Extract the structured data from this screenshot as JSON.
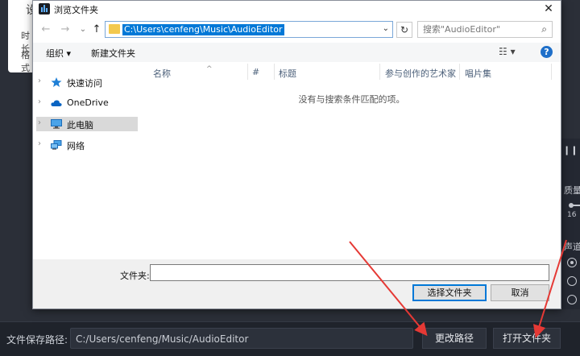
{
  "background": {
    "settings_panel": {
      "title": "设",
      "row1": "时长",
      "row2": "格式"
    },
    "right_panel": {
      "pause_glyph": "❙❙",
      "quality_label": "质量",
      "quality_value": "16",
      "channel_label": "声道"
    },
    "bottom_bar": {
      "save_path_label": "文件保存路径:",
      "save_path_value": "C:/Users/cenfeng/Music/AudioEditor",
      "change_path_button": "更改路径",
      "open_folder_button": "打开文件夹"
    }
  },
  "dialog": {
    "title": "浏览文件夹",
    "close_glyph": "✕",
    "nav": {
      "back": "←",
      "forward": "→",
      "dropdown": "⌄",
      "up": "↑"
    },
    "address": "C:\\Users\\cenfeng\\Music\\AudioEditor",
    "address_dropdown": "⌄",
    "refresh_glyph": "↻",
    "search_placeholder": "搜索\"AudioEditor\"",
    "search_glyph": "⌕",
    "toolbar": {
      "organize": "组织 ▾",
      "new_folder": "新建文件夹",
      "view_glyph": "☷ ▾",
      "help_glyph": "?"
    },
    "sidebar": [
      {
        "label": "快速访问",
        "icon": "star-icon"
      },
      {
        "label": "OneDrive",
        "icon": "cloud-icon"
      },
      {
        "label": "此电脑",
        "icon": "computer-icon",
        "selected": true
      },
      {
        "label": "网络",
        "icon": "network-icon"
      }
    ],
    "columns": [
      "名称",
      "#",
      "标题",
      "参与创作的艺术家",
      "唱片集"
    ],
    "sort_glyph": "^",
    "empty_message": "没有与搜索条件匹配的项。",
    "footer": {
      "folder_label": "文件夹:",
      "select_button": "选择文件夹",
      "cancel_button": "取消"
    }
  },
  "colors": {
    "accent": "#0078d7",
    "annotation_arrow": "#e53935",
    "app_background": "#2b2f38"
  }
}
